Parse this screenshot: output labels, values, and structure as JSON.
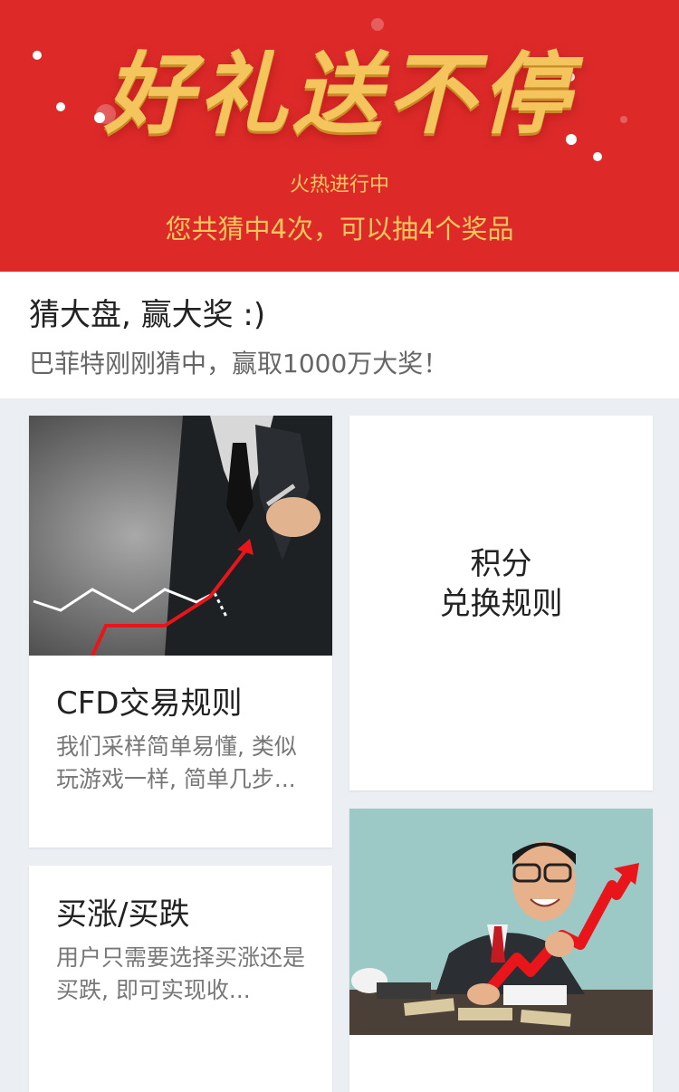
{
  "banner": {
    "headline": "好礼送不停",
    "subtitle": "火热进行中",
    "count_text": "您共猜中4次，可以抽4个奖品"
  },
  "intro": {
    "title": "猜大盘, 赢大奖 :)",
    "description": "巴菲特刚刚猜中，赢取1000万大奖！"
  },
  "cards": {
    "cfd": {
      "title": "CFD交易规则",
      "description": "我们采样简单易懂, 类似玩游戏一样, 简单几步..."
    },
    "points": {
      "line1": "积分",
      "line2": "兑换规则"
    },
    "updown": {
      "title": "买涨/买跌",
      "description": "用户只需要选择买涨还是买跌, 即可实现收..."
    }
  },
  "colors": {
    "banner_red": "#dd2a29",
    "gold": "#f4c55c",
    "arrow_red": "#e8151b"
  }
}
